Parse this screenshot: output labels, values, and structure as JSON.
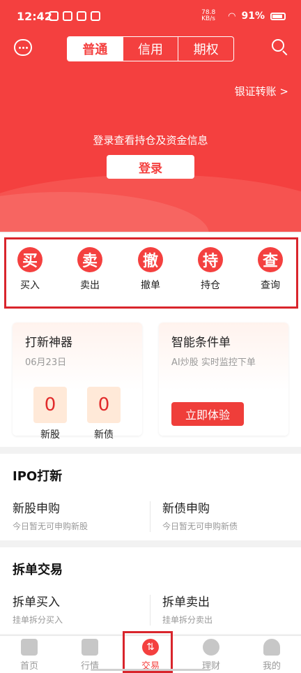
{
  "statusbar": {
    "time": "12:42",
    "speed": "78.8 KB/s",
    "battery": "91%"
  },
  "header": {
    "tabs": [
      {
        "label": "普通",
        "active": true
      },
      {
        "label": "信用"
      },
      {
        "label": "期权"
      }
    ],
    "transfer": "银证转账 >",
    "login_tip": "登录查看持仓及资金信息",
    "login_button": "登录"
  },
  "actions": [
    {
      "icon": "买",
      "label": "买入"
    },
    {
      "icon": "卖",
      "label": "卖出"
    },
    {
      "icon": "撤",
      "label": "撤单"
    },
    {
      "icon": "持",
      "label": "持仓"
    },
    {
      "icon": "查",
      "label": "查询"
    }
  ],
  "cards": {
    "ipo_tool": {
      "title": "打新神器",
      "date": "06月23日",
      "stock_count": "0",
      "stock_label": "新股",
      "bond_count": "0",
      "bond_label": "新债"
    },
    "smart_order": {
      "title": "智能条件单",
      "subtitle": "AI炒股 实时监控下单",
      "button": "立即体验"
    }
  },
  "ipo_section": {
    "title": "IPO打新",
    "left": {
      "title": "新股申购",
      "desc": "今日暂无可申购新股"
    },
    "right": {
      "title": "新债申购",
      "desc": "今日暂无可申购新债"
    }
  },
  "split_section": {
    "title": "拆单交易",
    "left": {
      "title": "拆单买入",
      "desc": "挂单拆分买入"
    },
    "right": {
      "title": "拆单卖出",
      "desc": "挂单拆分卖出"
    }
  },
  "tabbar": [
    {
      "label": "首页",
      "icon": "home-icon"
    },
    {
      "label": "行情",
      "icon": "chart-icon"
    },
    {
      "label": "交易",
      "icon": "trade-icon",
      "active": true
    },
    {
      "label": "理财",
      "icon": "wealth-icon"
    },
    {
      "label": "我的",
      "icon": "user-icon"
    }
  ],
  "colors": {
    "brand_red": "#f4403f",
    "highlight_frame": "#d9252c"
  }
}
